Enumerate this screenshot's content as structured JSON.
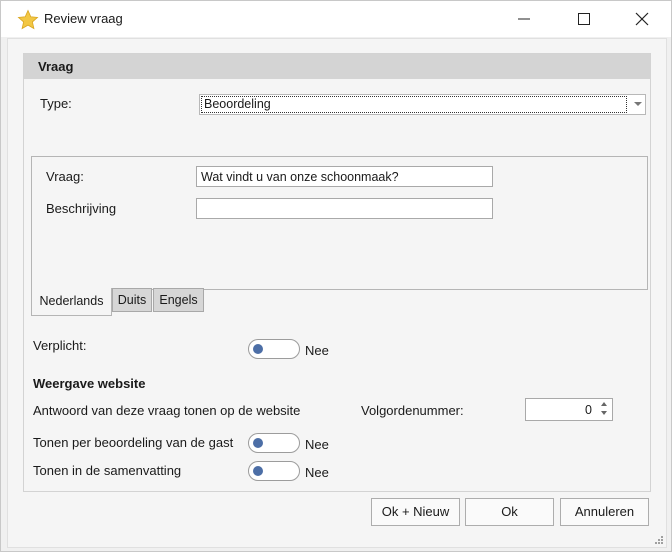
{
  "window": {
    "title": "Review vraag",
    "controls": {
      "minimize": "minimize-icon",
      "maximize": "maximize-icon",
      "close": "close-icon"
    }
  },
  "panel": {
    "title": "Vraag"
  },
  "type": {
    "label": "Type:",
    "value": "Beoordeling"
  },
  "question": {
    "vraag_label": "Vraag:",
    "vraag_value": "Wat vindt u van onze schoonmaak?",
    "beschrijving_label": "Beschrijving",
    "beschrijving_value": ""
  },
  "tabs": [
    {
      "label": "Nederlands",
      "active": true
    },
    {
      "label": "Duits",
      "active": false
    },
    {
      "label": "Engels",
      "active": false
    }
  ],
  "verplicht": {
    "label": "Verplicht:",
    "state": "Nee"
  },
  "website": {
    "title": "Weergave website",
    "show_label": "Antwoord van deze vraag tonen op de website",
    "order_label": "Volgordenummer:",
    "order_value": "0",
    "per_guest_label": "Tonen per beoordeling van de gast",
    "per_guest_state": "Nee",
    "summary_label": "Tonen in de samenvatting",
    "summary_state": "Nee"
  },
  "buttons": {
    "ok_new": "Ok + Nieuw",
    "ok": "Ok",
    "cancel": "Annuleren"
  },
  "colors": {
    "accent": "#4c6ea6",
    "star": "#f2c744"
  }
}
